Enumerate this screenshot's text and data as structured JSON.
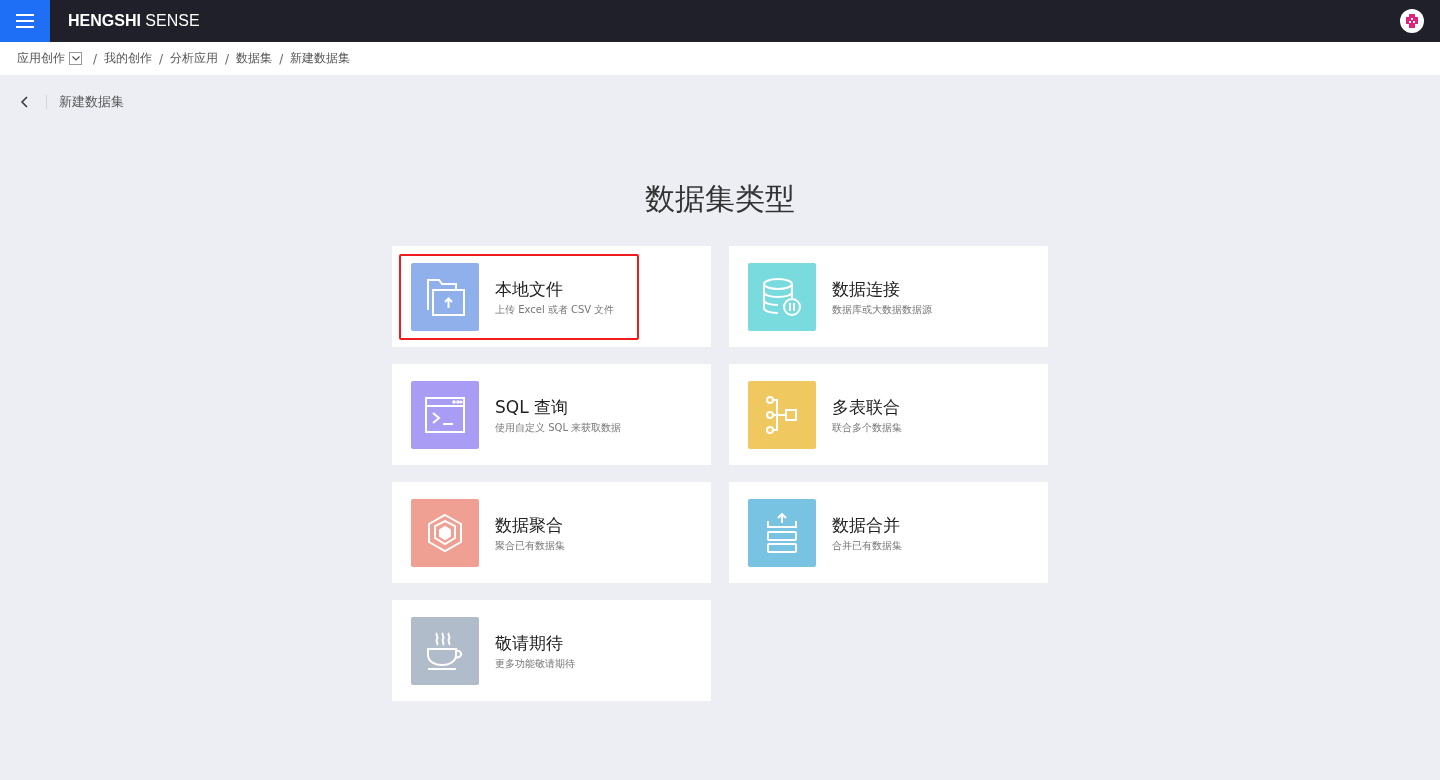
{
  "topbar": {
    "logo": "**HENGSHI** SENSE"
  },
  "breadcrumb": [
    {
      "label": "应用创作",
      "dropdown": true
    },
    {
      "separator": "/",
      "label": "我的创作"
    },
    {
      "separator": "/",
      "label": "分析应用"
    },
    {
      "separator": "/",
      "label": "数据集"
    },
    {
      "separator": "/",
      "label": "新建数据集"
    }
  ],
  "page_header": {
    "title": "新建数据集"
  },
  "heading": "数据集类型",
  "cards": [
    {
      "kind": "file",
      "title": "本地文件",
      "subtitle": "上传 Excel 或者 CSV 文件",
      "color": "#8fb0ea",
      "highlighted": true
    },
    {
      "kind": "database",
      "title": "数据连接",
      "subtitle": "数据库或大数据数据源",
      "color": "#7adbdf",
      "highlighted": false
    },
    {
      "kind": "sql",
      "title": "SQL 查询",
      "subtitle": "使用自定义 SQL 来获取数据",
      "color": "#a99cf5",
      "highlighted": false
    },
    {
      "kind": "join",
      "title": "多表联合",
      "subtitle": "联合多个数据集",
      "color": "#f0c860",
      "highlighted": false
    },
    {
      "kind": "aggregate",
      "title": "数据聚合",
      "subtitle": "聚合已有数据集",
      "color": "#f0a093",
      "highlighted": false
    },
    {
      "kind": "merge",
      "title": "数据合并",
      "subtitle": "合并已有数据集",
      "color": "#79c3e2",
      "highlighted": false
    },
    {
      "kind": "coming",
      "title": "敬请期待",
      "subtitle": "更多功能敬请期待",
      "color": "#b1bccb",
      "highlighted": false
    }
  ]
}
